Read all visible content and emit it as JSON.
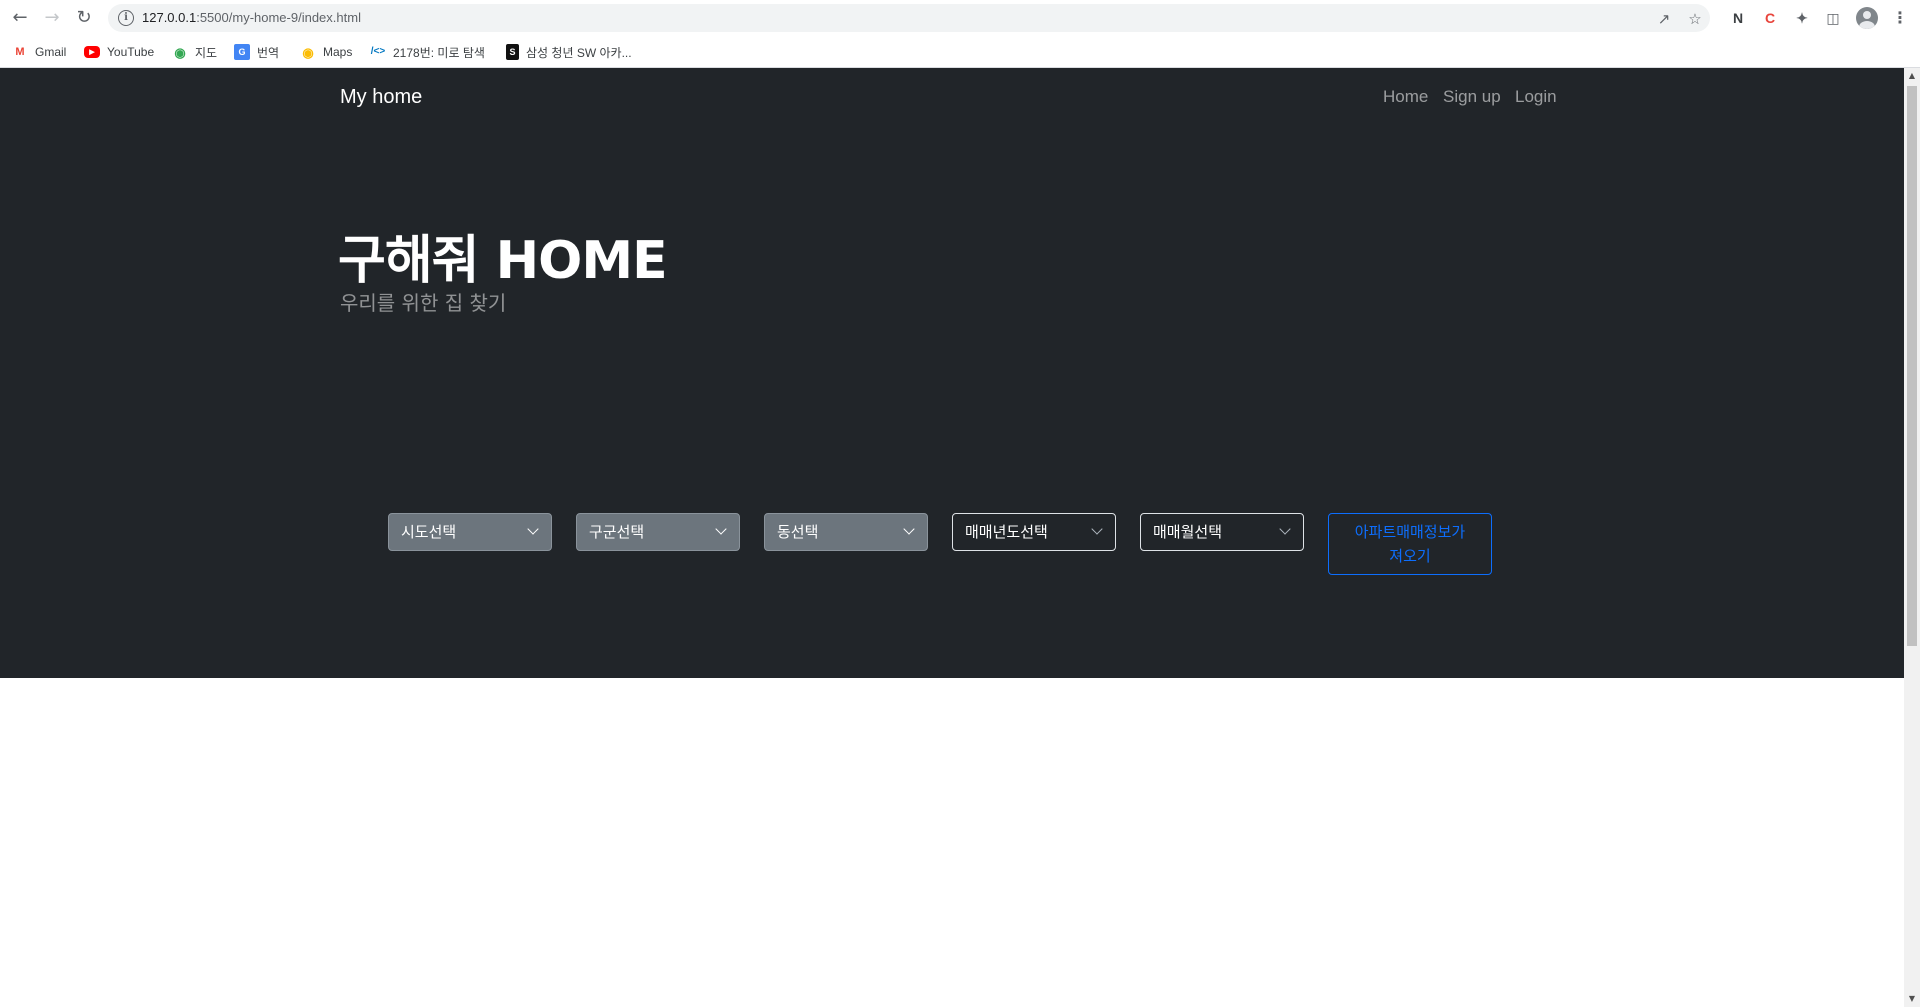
{
  "browser": {
    "url_host": "127.0.0.1",
    "url_path": ":5500/my-home-9/index.html",
    "bookmarks": [
      {
        "label": "Gmail"
      },
      {
        "label": "YouTube"
      },
      {
        "label": "지도"
      },
      {
        "label": "번역"
      },
      {
        "label": "Maps"
      },
      {
        "label": "2178번: 미로 탐색"
      },
      {
        "label": "삼성 청년 SW 아카..."
      }
    ]
  },
  "navbar": {
    "brand": "My home",
    "links": [
      "Home",
      "Sign up",
      "Login"
    ]
  },
  "hero": {
    "title": "구해줘 HOME",
    "subtitle": "우리를 위한 집 찾기"
  },
  "filters": {
    "sido": "시도선택",
    "gugun": "구군선택",
    "dong": "동선택",
    "year": "매매년도선택",
    "month": "매매월선택"
  },
  "search_button": {
    "line1": "아파트매매정보가",
    "line2": "져오기"
  },
  "colors": {
    "hero_bg": "#212529",
    "select_filled": "#6c757d",
    "primary": "#0d6efd"
  }
}
